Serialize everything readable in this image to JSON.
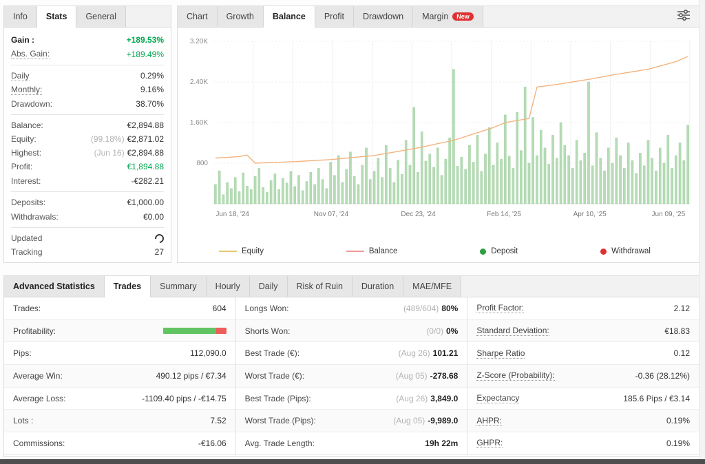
{
  "left_panel": {
    "tabs": [
      {
        "label": "Info"
      },
      {
        "label": "Stats",
        "active": true
      },
      {
        "label": "General"
      }
    ],
    "rows": [
      {
        "label": "Gain :",
        "value": "+189.53%",
        "bold_label": true,
        "green": true,
        "bold_value": true
      },
      {
        "label": "Abs. Gain:",
        "value": "+189.49%",
        "underline": true,
        "green": true,
        "divider": true
      },
      {
        "label": "Daily",
        "value": "0.29%",
        "underline": true
      },
      {
        "label": "Monthly:",
        "value": "9.16%",
        "underline": true
      },
      {
        "label": "Drawdown:",
        "value": "38.70%",
        "divider": true
      },
      {
        "label": "Balance:",
        "value": "€2,894.88"
      },
      {
        "label": "Equity:",
        "prefix": "(99.18%)",
        "value": "€2,871.02"
      },
      {
        "label": "Highest:",
        "prefix": "(Jun 16)",
        "value": "€2,894.88"
      },
      {
        "label": "Profit:",
        "value": "€1,894.88",
        "green": true
      },
      {
        "label": "Interest:",
        "value": "-€282.21",
        "divider": true
      },
      {
        "label": "Deposits:",
        "value": "€1,000.00"
      },
      {
        "label": "Withdrawals:",
        "value": "€0.00",
        "divider": true
      },
      {
        "label": "Updated",
        "spinner": true
      },
      {
        "label": "Tracking",
        "value": "27"
      }
    ]
  },
  "chart_panel": {
    "tabs": [
      {
        "label": "Chart"
      },
      {
        "label": "Growth"
      },
      {
        "label": "Balance",
        "active": true
      },
      {
        "label": "Profit"
      },
      {
        "label": "Drawdown"
      },
      {
        "label": "Margin",
        "badge": "New"
      }
    ]
  },
  "chart_data": {
    "type": "bar",
    "title": "",
    "xlabel": "",
    "ylabel": "",
    "x_range": [
      "Jun 18, '24",
      "Jun 09, '25"
    ],
    "ylim": [
      0,
      3200
    ],
    "y_ticks": [
      "3.20K",
      "2.40K",
      "1.60K",
      "800"
    ],
    "y_tick_values": [
      3200,
      2400,
      1600,
      800
    ],
    "x_tick_labels": [
      "Jun 18, '24",
      "Nov 07, '24",
      "Dec 23, '24",
      "Feb 14, '25",
      "Apr 10, '25",
      "Jun 09, '25"
    ],
    "x_tick_fractions": [
      0.04,
      0.247,
      0.43,
      0.61,
      0.79,
      0.955
    ],
    "grid": true,
    "legend_position": "bottom",
    "series": [
      {
        "name": "Balance bars",
        "type": "bar",
        "values": [
          380,
          650,
          180,
          420,
          300,
          520,
          240,
          610,
          350,
          280,
          540,
          700,
          320,
          230,
          460,
          590,
          280,
          500,
          410,
          640,
          340,
          560,
          260,
          440,
          620,
          380,
          700,
          480,
          300,
          820,
          560,
          950,
          420,
          680,
          1020,
          540,
          380,
          760,
          1100,
          480,
          640,
          900,
          520,
          1150,
          700,
          420,
          860,
          580,
          1250,
          760,
          1900,
          620,
          1420,
          840,
          980,
          720,
          1100,
          560,
          880,
          1300,
          2650,
          740,
          920,
          680,
          1150,
          820,
          1350,
          640,
          980,
          1500,
          760,
          1200,
          880,
          1750,
          940,
          700,
          1800,
          1050,
          2300,
          800,
          1700,
          950,
          1450,
          1100,
          780,
          1350,
          900,
          1600,
          1150,
          950,
          700,
          1250,
          850,
          1000,
          2400,
          750,
          1400,
          900,
          650,
          1100,
          800,
          1300,
          950,
          700,
          1200,
          850,
          600,
          1000,
          750,
          1250,
          900,
          650,
          1100,
          800,
          1350,
          700,
          950,
          1200,
          850,
          1550
        ]
      },
      {
        "name": "Equity line",
        "type": "line",
        "waypoints": [
          [
            0,
            900
          ],
          [
            6,
            930
          ],
          [
            8,
            960
          ],
          [
            10,
            800
          ],
          [
            20,
            830
          ],
          [
            29,
            870
          ],
          [
            40,
            950
          ],
          [
            51,
            1100
          ],
          [
            60,
            1250
          ],
          [
            70,
            1500
          ],
          [
            73,
            1600
          ],
          [
            79,
            1680
          ],
          [
            81,
            2300
          ],
          [
            86,
            2350
          ],
          [
            94,
            2450
          ],
          [
            101,
            2550
          ],
          [
            109,
            2650
          ],
          [
            116,
            2800
          ],
          [
            119,
            2900
          ]
        ]
      }
    ],
    "legend": [
      {
        "label": "Equity",
        "type": "line",
        "color": "#e6c96a"
      },
      {
        "label": "Balance",
        "type": "line",
        "color": "#f19999"
      },
      {
        "label": "Deposit",
        "type": "dot",
        "color": "#2f9e44"
      },
      {
        "label": "Withdrawal",
        "type": "dot",
        "color": "#e03131"
      }
    ],
    "colors": {
      "bar": "#b5dcb5",
      "bar_stroke": "#9ccc9c",
      "line": "#f2b37e",
      "grid": "#efefef",
      "axis_text": "#8a8a8a"
    }
  },
  "bottom_panel": {
    "tabs": [
      {
        "label": "Advanced Statistics",
        "bold": true
      },
      {
        "label": "Trades",
        "active": true
      },
      {
        "label": "Summary"
      },
      {
        "label": "Hourly"
      },
      {
        "label": "Daily"
      },
      {
        "label": "Risk of Ruin"
      },
      {
        "label": "Duration"
      },
      {
        "label": "MAE/MFE"
      }
    ],
    "profitability_bar": {
      "green_pct": 84,
      "red_pct": 16,
      "green_color": "#62c462",
      "red_color": "#ee5f5b"
    },
    "columns": [
      {
        "rows": [
          {
            "label": "Trades:",
            "value": "604"
          },
          {
            "label": "Profitability:",
            "bar": true
          },
          {
            "label": "Pips:",
            "value": "112,090.0"
          },
          {
            "label": "Average Win:",
            "value": "490.12 pips / €7.34"
          },
          {
            "label": "Average Loss:",
            "value": "-1109.40 pips / -€14.75"
          },
          {
            "label": "Lots :",
            "value": "7.52"
          },
          {
            "label": "Commissions:",
            "value": "-€16.06"
          }
        ]
      },
      {
        "rows": [
          {
            "label": "Longs Won:",
            "prefix": "(489/604)",
            "value": "80%",
            "bold": true
          },
          {
            "label": "Shorts Won:",
            "prefix": "(0/0)",
            "value": "0%",
            "bold": true
          },
          {
            "label": "Best Trade (€):",
            "prefix": "(Aug 26)",
            "value": "101.21",
            "bold": true
          },
          {
            "label": "Worst Trade (€):",
            "prefix": "(Aug 05)",
            "value": "-278.68",
            "bold": true
          },
          {
            "label": "Best Trade (Pips):",
            "prefix": "(Aug 26)",
            "value": "3,849.0",
            "bold": true
          },
          {
            "label": "Worst Trade (Pips):",
            "prefix": "(Aug 05)",
            "value": "-9,989.0",
            "bold": true
          },
          {
            "label": "Avg. Trade Length:",
            "value": "19h 22m",
            "bold": true
          }
        ]
      },
      {
        "rows": [
          {
            "label": "Profit Factor:",
            "value": "2.12",
            "underline": true
          },
          {
            "label": "Standard Deviation:",
            "value": "€18.83",
            "underline": true
          },
          {
            "label": "Sharpe Ratio",
            "value": "0.12",
            "underline": true
          },
          {
            "label": "Z-Score (Probability):",
            "value": "-0.36 (28.12%)",
            "underline": true
          },
          {
            "label": "Expectancy",
            "value": "185.6 Pips / €3.14",
            "underline": true
          },
          {
            "label": "AHPR:",
            "value": "0.19%",
            "underline": true
          },
          {
            "label": "GHPR:",
            "value": "0.19%",
            "underline": true
          }
        ]
      }
    ]
  },
  "colors": {
    "green": "#00a651",
    "badge_red": "#e03131",
    "muted": "#b3b3b3"
  }
}
